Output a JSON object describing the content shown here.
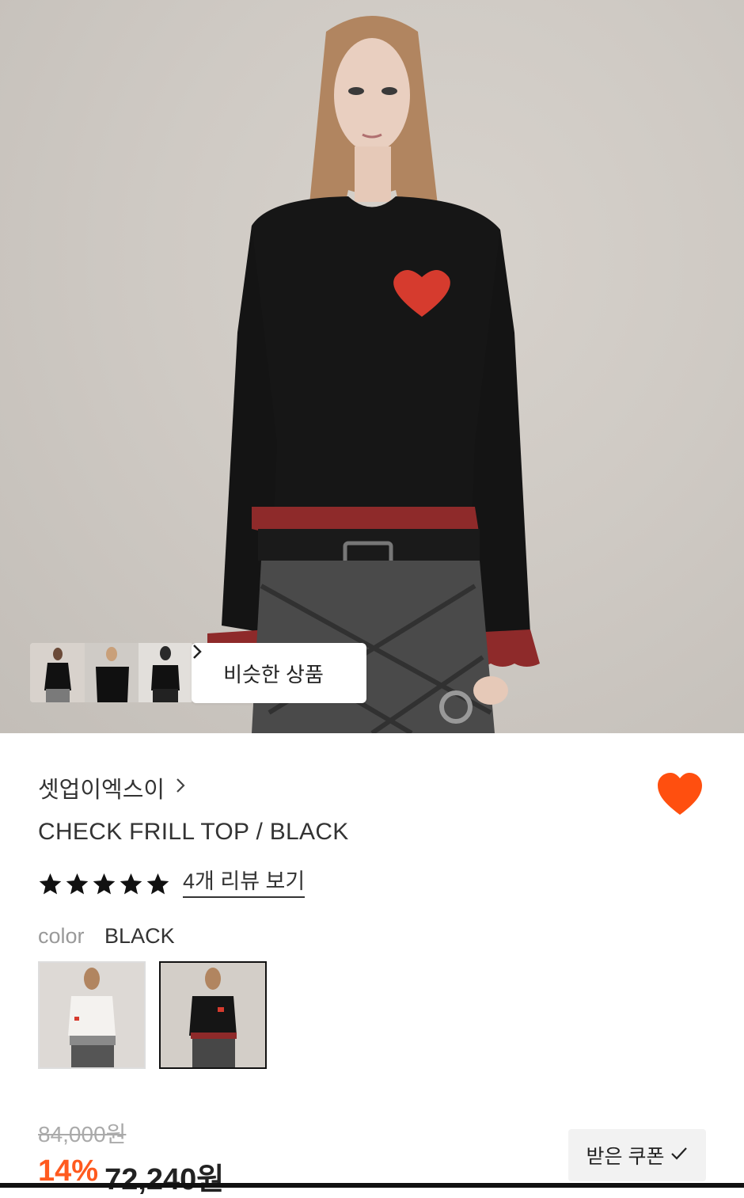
{
  "similar": {
    "label": "비슷한 상품",
    "chevron_icon": "chevron-right-icon"
  },
  "brand": {
    "name": "셋업이엑스이",
    "chevron_icon": "chevron-right-icon"
  },
  "favorite": {
    "icon": "heart-icon",
    "color": "#ff4f0f",
    "active": true
  },
  "product": {
    "title": "CHECK FRILL TOP / BLACK"
  },
  "rating": {
    "stars": 5,
    "max": 5,
    "review_label": "4개 리뷰 보기"
  },
  "color": {
    "label": "color",
    "value": "BLACK",
    "options": [
      "WHITE",
      "BLACK"
    ],
    "selected_index": 1
  },
  "price": {
    "original": "84,000원",
    "discount": "14%",
    "current": "72,240원"
  },
  "coupon": {
    "label": "받은 쿠폰",
    "icon": "check-icon"
  },
  "colors": {
    "accent": "#ff5a1f",
    "text": "#222222",
    "muted": "#999999"
  }
}
